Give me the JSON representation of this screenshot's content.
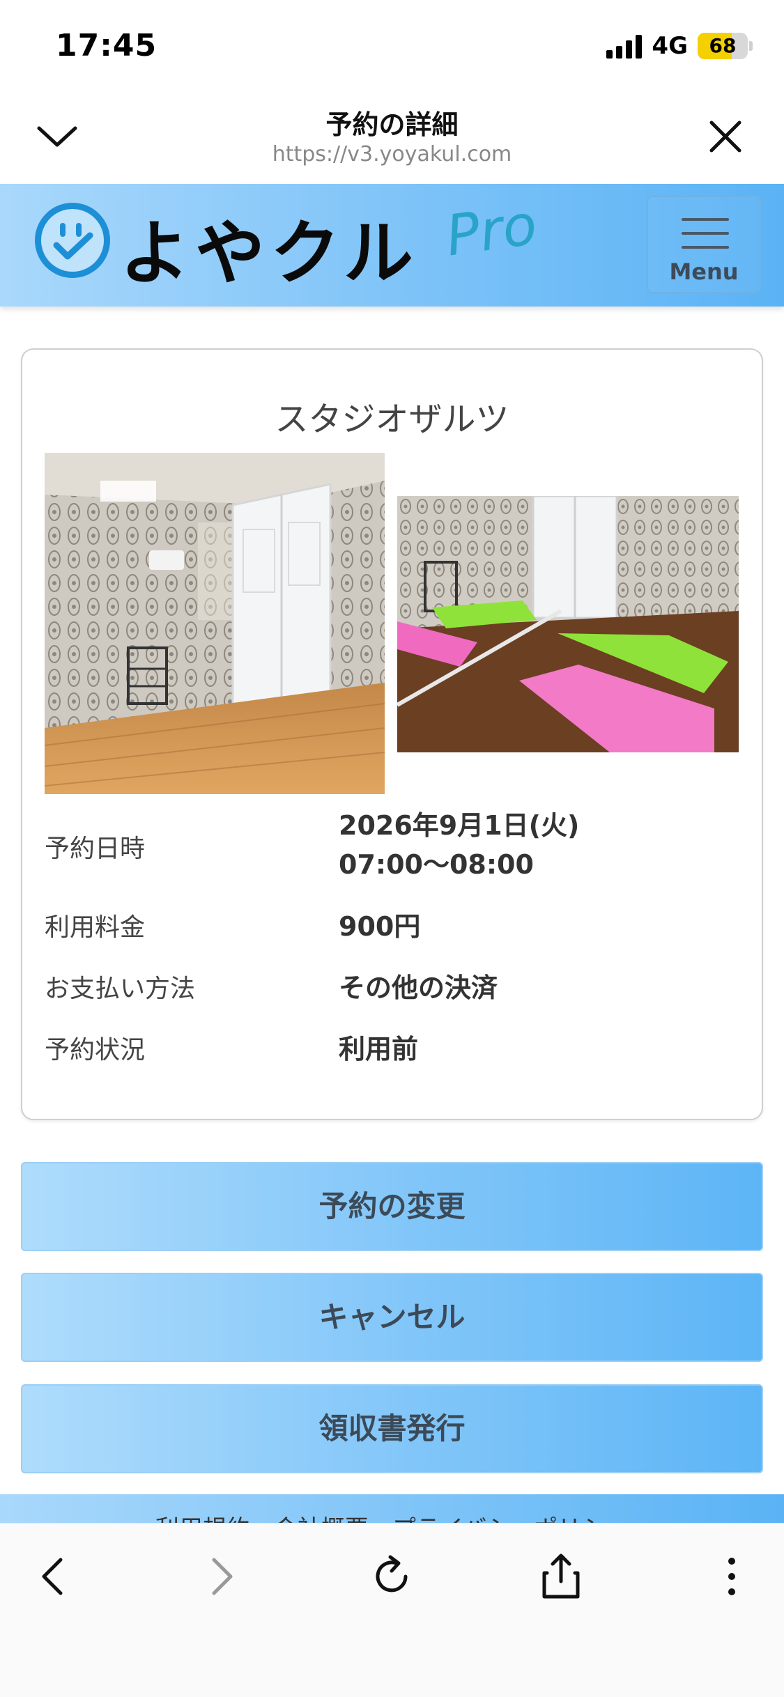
{
  "status_bar": {
    "time": "17:45",
    "network": "4G",
    "battery": "68",
    "battery_level_percent": 68
  },
  "browser": {
    "page_title": "予約の詳細",
    "url": "https://v3.yoyakul.com",
    "icons": [
      "chevron-down-icon",
      "close-icon",
      "back-icon",
      "forward-icon",
      "reload-icon",
      "share-icon",
      "more-icon"
    ]
  },
  "site_header": {
    "logo_text": "よやクル",
    "logo_pro": "Pro",
    "menu_label": "Menu"
  },
  "reservation": {
    "studio_name": "スタジオザルツ",
    "date_label": "予約日時",
    "date_value": "2026年9月1日(火)",
    "time_value": "07:00〜08:00",
    "fee_label": "利用料金",
    "fee_value": "900円",
    "payment_label": "お支払い方法",
    "payment_value": "その他の決済",
    "status_label": "予約状況",
    "status_value": "利用前"
  },
  "actions": {
    "change": "予約の変更",
    "cancel": "キャンセル",
    "receipt": "領収書発行"
  },
  "footer": {
    "links_text": "利用規約　会社概要　プライバシーポリシー"
  },
  "colors": {
    "header_gradient_start": "#a9d8fb",
    "header_gradient_end": "#5ab3f5",
    "logo_blue": "#1d8fd6",
    "pro_teal": "#2aa3c8",
    "battery_yellow": "#f5d000"
  }
}
